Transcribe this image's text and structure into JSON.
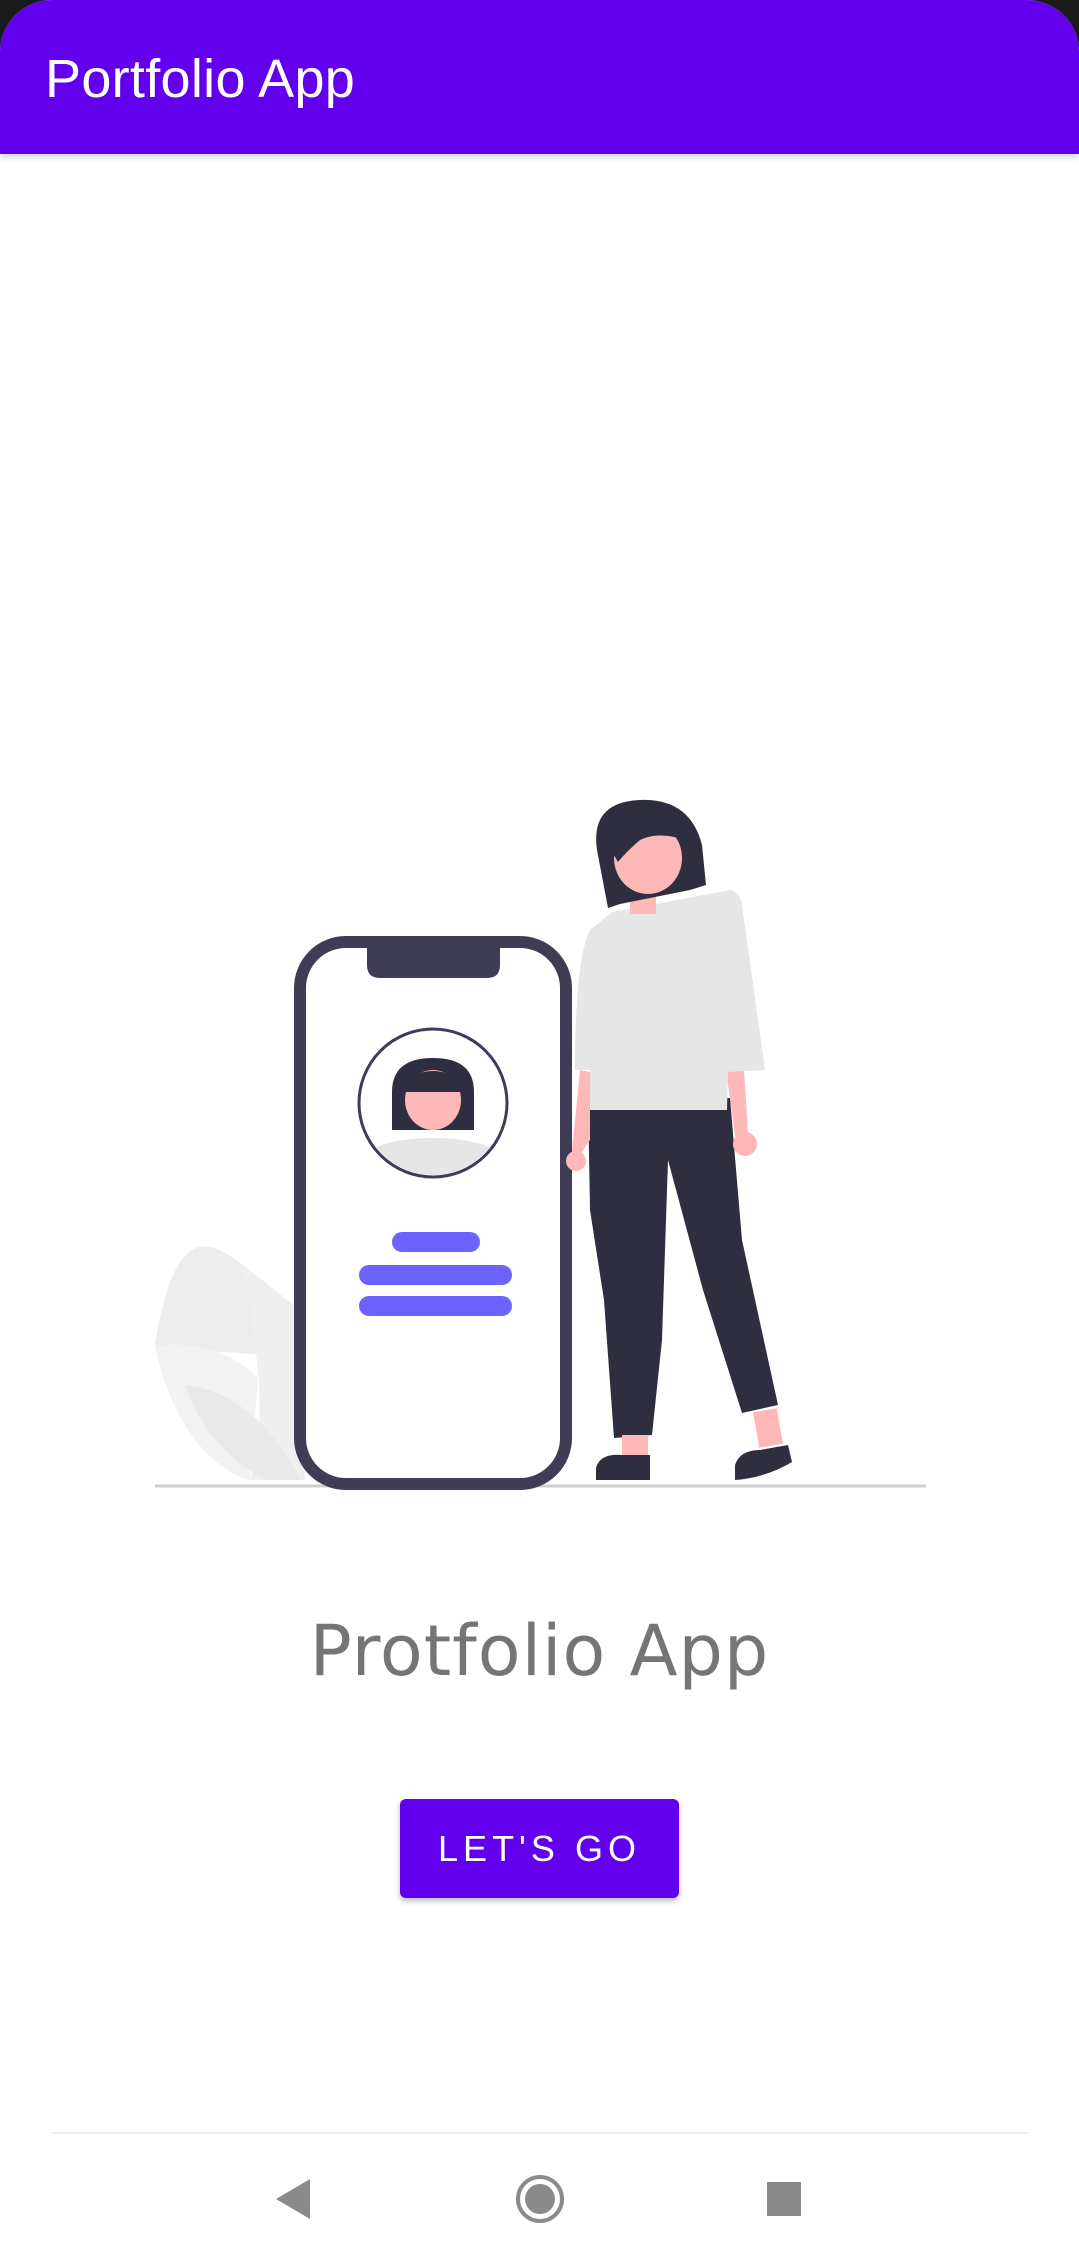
{
  "app_bar": {
    "title": "Portfolio App",
    "color": "#6200ee"
  },
  "illustration": {
    "semantic": "woman-standing-next-to-phone-with-profile-illustration",
    "accent_color": "#6c63ff",
    "dark_color": "#2f2e41",
    "skin_color": "#ffb8b8"
  },
  "main": {
    "title": "Protfolio App",
    "cta_label": "LET'S GO",
    "cta_color": "#6200ee"
  },
  "nav_bar": {
    "back_icon": "back-triangle-icon",
    "home_icon": "home-circle-icon",
    "recents_icon": "recents-square-icon"
  }
}
